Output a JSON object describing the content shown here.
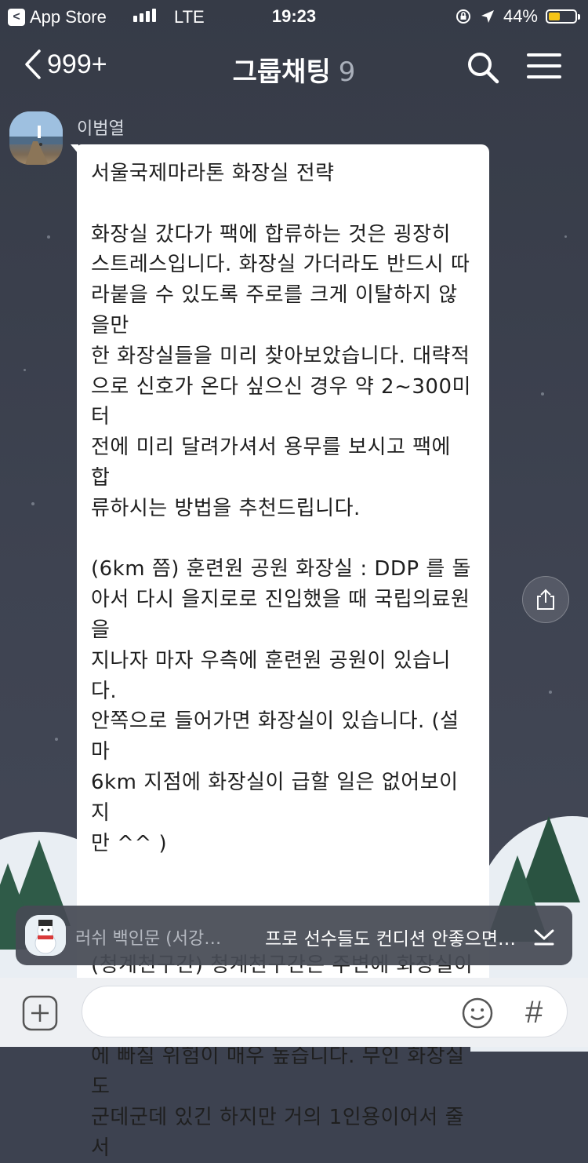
{
  "status_bar": {
    "back_app": "App Store",
    "network": "LTE",
    "time": "19:23",
    "battery_percent": "44%",
    "battery_level": 0.44
  },
  "nav": {
    "back_count": "999+",
    "title": "그룹채팅",
    "member_count": "9"
  },
  "message": {
    "sender": "이범열",
    "text": "서울국제마라톤 화장실 전략\n\n화장실 갔다가 팩에 합류하는 것은 굉장히\n스트레스입니다. 화장실 가더라도 반드시 따\n라붙을 수 있도록 주로를 크게 이탈하지 않을만\n한 화장실들을 미리 찾아보았습니다. 대략적\n으로 신호가 온다 싶으신 경우 약 2~300미터\n전에 미리 달려가셔서 용무를 보시고 팩에 합\n류하시는 방법을 추천드립니다.\n\n(6km 쯤) 훈련원 공원 화장실 : DDP 를 돌\n아서 다시 을지로로 진입했을 때 국립의료원을\n지나자 마자 우측에 훈련원 공원이 있습니다.\n안쪽으로 들어가면 화장실이 있습니다. (설마\n6km 지점에 화장실이 급할 일은 없어보이지\n만 ^^ )\n\n\n\n(청계천구간) 청계천구간은 주변에 화장실이\n매우 많지만, 건물 안에 있는 경우가 많아서,\n마음도 급한데 건물안에서 헤매게 되면 멘붕\n에 빠질 위험이 매우 높습니다. 무인 화장실도\n군데군데 있긴 하지만 거의 1인용이어서 줄서"
  },
  "notice": {
    "name": "러쉬 백인문 (서강…",
    "message": "프로 선수들도 컨디션 안좋으면…"
  },
  "input": {
    "hash_label": "#"
  },
  "colors": {
    "background": "#3d4250",
    "battery": "#f5c518"
  }
}
